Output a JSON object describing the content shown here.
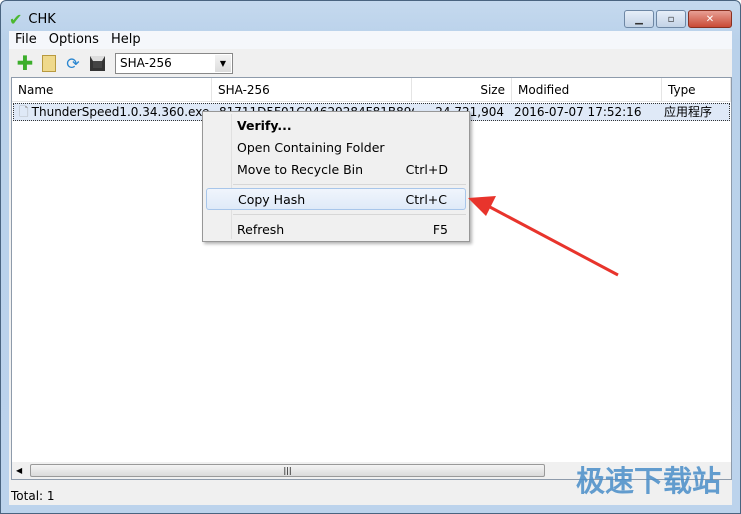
{
  "window": {
    "title": "CHK"
  },
  "menu": [
    "File",
    "Options",
    "Help"
  ],
  "toolbar": {
    "icons": [
      "add-icon",
      "open-folder-icon",
      "refresh-icon",
      "save-icon"
    ],
    "algorithm": "SHA-256"
  },
  "list": {
    "columns": [
      "Name",
      "SHA-256",
      "Size",
      "Modified",
      "Type"
    ],
    "rows": [
      {
        "name": "ThunderSpeed1.0.34.360.exe",
        "hash": "81711D5F01C04629284F81B89C1C",
        "size": "24,721,904",
        "modified": "2016-07-07 17:52:16",
        "type": "应用程序"
      }
    ]
  },
  "context_menu": {
    "items": [
      {
        "label": "Verify...",
        "shortcut": ""
      },
      {
        "label": "Open Containing Folder",
        "shortcut": ""
      },
      {
        "label": "Move to Recycle Bin",
        "shortcut": "Ctrl+D"
      },
      {
        "label": "Copy Hash",
        "shortcut": "Ctrl+C"
      },
      {
        "label": "Refresh",
        "shortcut": "F5"
      }
    ]
  },
  "status": "Total: 1",
  "watermark": "极速下载站",
  "colors": {
    "arrow": "#e8342c",
    "highlight": "#dfe9f7"
  }
}
